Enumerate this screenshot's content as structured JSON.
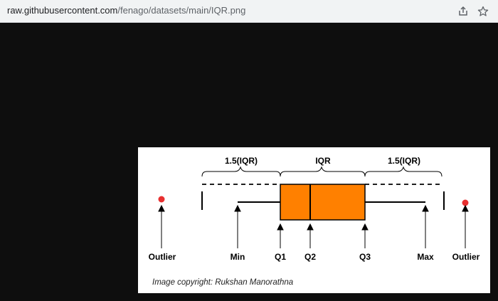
{
  "browser": {
    "url_host": "raw.githubusercontent.com",
    "url_path": "/fenago/datasets/main/IQR.png",
    "share_icon": "share-icon",
    "bookmark_icon": "star-icon"
  },
  "diagram": {
    "labels": {
      "left_whisker_range": "1.5(IQR)",
      "iqr": "IQR",
      "right_whisker_range": "1.5(IQR)",
      "outlier_left": "Outlier",
      "min": "Min",
      "q1": "Q1",
      "q2": "Q2",
      "q3": "Q3",
      "max": "Max",
      "outlier_right": "Outlier"
    },
    "copyright": "Image copyright: Rukshan Manorathna",
    "colors": {
      "box_fill": "#ff8000",
      "outlier": "#e83030",
      "line": "#000000"
    }
  }
}
